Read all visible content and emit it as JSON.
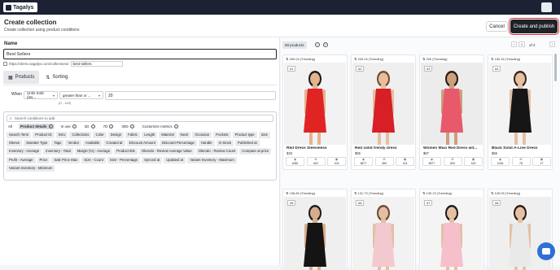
{
  "brand": {
    "name": "Tagalys"
  },
  "header": {
    "title": "Create collection",
    "subtitle": "Create collection using product conditions",
    "cancel_label": "Cancel",
    "publish_label": "Create and publish"
  },
  "form": {
    "name_label": "Name",
    "name_value": "Best Sellers",
    "url_prefix": "https://demo.tagalys.com/collections/",
    "url_slug": "best-sellers"
  },
  "tabs": [
    {
      "label": "Products",
      "icon": "products-icon",
      "active": true
    },
    {
      "label": "Sorting",
      "icon": "sorting-icon",
      "active": false
    }
  ],
  "condition": {
    "when_label": "When",
    "field": "Units Sold (las...",
    "operator": "greater than or ...",
    "value": "20",
    "range_hint": "(0 - 143)"
  },
  "conditions_panel": {
    "search_placeholder": "Search conditions to add",
    "filters": [
      {
        "label": "All",
        "active": false,
        "info": false
      },
      {
        "label": "Product details",
        "active": true,
        "info": true
      },
      {
        "label": "In use",
        "active": false,
        "info": true
      },
      {
        "label": "3D",
        "active": false,
        "info": true
      },
      {
        "label": "7D",
        "active": false,
        "info": true
      },
      {
        "label": "30D",
        "active": false,
        "info": true
      },
      {
        "label": "Customize metrics",
        "active": false,
        "info": true
      }
    ],
    "chips": [
      "Search Term",
      "Product ID",
      "SKU",
      "Collections",
      "Color",
      "Design",
      "Fabric",
      "Length",
      "Material",
      "Neck",
      "Occasion",
      "Pockets",
      "Product type",
      "Size",
      "Sleeve",
      "Sweater Type",
      "Tags",
      "Vendor",
      "Available",
      "Created at",
      "Discount Amount",
      "Discount Percentage",
      "Handle",
      "In Stock",
      "Published at",
      "Inventory - Average",
      "Inventory - Total",
      "Margin (%) - Average",
      "Product title",
      "Okendo - Review Average Value",
      "Okendo - Review Count",
      "Compare at price",
      "Profit - Average",
      "Price",
      "Sale Price Max",
      "Size - Count",
      "Size - Percentage",
      "Synced at",
      "Updated at",
      "Variant Inventory - Maximum",
      "Variant Inventory - Minimum"
    ]
  },
  "results": {
    "count_label": "58 products",
    "page_current": "1",
    "page_total_label": "of 2",
    "products": [
      {
        "trend": "200.04 (Trending)",
        "rank": "#1",
        "name": "Red Dress Sleeveless",
        "price": "$33",
        "stats": [
          "4082",
          "602",
          "104"
        ],
        "dress": "#e02424",
        "skin": "#e4b48f",
        "hair": "#1a1a1a",
        "bg": "#f2f2f2"
      },
      {
        "trend": "200.04 (Trending)",
        "rank": "#2",
        "name": "Red solid trendy dress",
        "price": "$55",
        "stats": [
          "5877",
          "389",
          "104"
        ],
        "dress": "#d81f26",
        "skin": "#e6bfa0",
        "hair": "#7a4a2a",
        "bg": "#efefef"
      },
      {
        "trend": "200 (Trending)",
        "rank": "#3",
        "name": "Women Maxi Red Dress wit...",
        "price": "$67",
        "stats": [
          "5877",
          "600",
          "163"
        ],
        "dress": "#e8596b",
        "skin": "#caa07e",
        "hair": "#2a1a12",
        "bg": "#ececec"
      },
      {
        "trend": "150.16 (Trending)",
        "rank": "#4",
        "name": "Black Solid A-Line Dress",
        "price": "$55",
        "stats": [
          "1236",
          "78",
          "27"
        ],
        "dress": "#161616",
        "skin": "#e4c0a4",
        "hair": "#3a2416",
        "bg": "#f3f3f3"
      },
      {
        "trend": "136.89 (Trending)",
        "rank": "#5",
        "name": "",
        "price": "",
        "stats": [
          "",
          "",
          ""
        ],
        "dress": "#141414",
        "skin": "#d9ad8a",
        "hair": "#1a1a1a",
        "bg": "#efefef"
      },
      {
        "trend": "131.73 (Trending)",
        "rank": "#6",
        "name": "",
        "price": "",
        "stats": [
          "",
          "",
          ""
        ],
        "dress": "#f2c9cf",
        "skin": "#e3bea3",
        "hair": "#6b4a32",
        "bg": "#f2f2f2"
      },
      {
        "trend": "130.19 (Trending)",
        "rank": "#7",
        "name": "",
        "price": "",
        "stats": [
          "",
          "",
          ""
        ],
        "dress": "#f6bfcc",
        "skin": "#e4c0a4",
        "hair": "#1a1a1a",
        "bg": "#f4f4f4"
      },
      {
        "trend": "125.09 (Trending)",
        "rank": "#8",
        "name": "",
        "price": "",
        "stats": [
          "",
          "",
          ""
        ],
        "dress": "#e9e9e9",
        "skin": "#e4c0a4",
        "hair": "#2a1a12",
        "bg": "#efefef"
      }
    ]
  }
}
